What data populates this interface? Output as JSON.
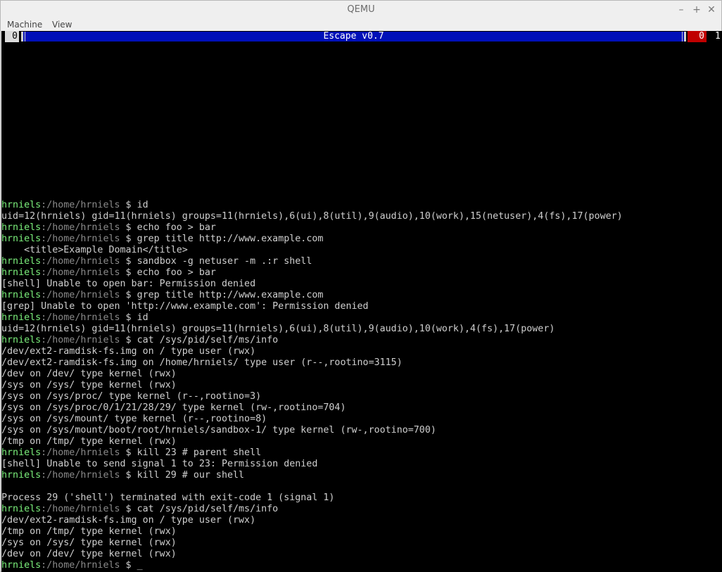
{
  "window": {
    "title": "QEMU",
    "minimize_glyph": "–",
    "maximize_glyph": "+",
    "close_glyph": "✕"
  },
  "menu": {
    "machine": "Machine",
    "view": "View"
  },
  "status": {
    "left_workspace": "0",
    "title": "Escape v0.7",
    "right_workspace_red": "0",
    "right_number": "1"
  },
  "terminal": {
    "user": "hrniels",
    "path": ":/home/hrniels",
    "prompt_symbol": " $ ",
    "lines": [
      {
        "type": "blank"
      },
      {
        "type": "prompt",
        "cmd": "id"
      },
      {
        "type": "output",
        "text": "uid=12(hrniels) gid=11(hrniels) groups=11(hrniels),6(ui),8(util),9(audio),10(work),15(netuser),4(fs),17(power)"
      },
      {
        "type": "prompt",
        "cmd": "echo foo > bar"
      },
      {
        "type": "prompt",
        "cmd": "grep title http://www.example.com"
      },
      {
        "type": "output",
        "text": "    <title>Example Domain</title>"
      },
      {
        "type": "prompt",
        "cmd": "sandbox -g netuser -m .:r shell"
      },
      {
        "type": "prompt",
        "cmd": "echo foo > bar"
      },
      {
        "type": "output",
        "text": "[shell] Unable to open bar: Permission denied"
      },
      {
        "type": "prompt",
        "cmd": "grep title http://www.example.com"
      },
      {
        "type": "output",
        "text": "[grep] Unable to open 'http://www.example.com': Permission denied"
      },
      {
        "type": "prompt",
        "cmd": "id"
      },
      {
        "type": "output",
        "text": "uid=12(hrniels) gid=11(hrniels) groups=11(hrniels),6(ui),8(util),9(audio),10(work),4(fs),17(power)"
      },
      {
        "type": "prompt",
        "cmd": "cat /sys/pid/self/ms/info"
      },
      {
        "type": "output",
        "text": "/dev/ext2-ramdisk-fs.img on / type user (rwx)"
      },
      {
        "type": "output",
        "text": "/dev/ext2-ramdisk-fs.img on /home/hrniels/ type user (r--,rootino=3115)"
      },
      {
        "type": "output",
        "text": "/dev on /dev/ type kernel (rwx)"
      },
      {
        "type": "output",
        "text": "/sys on /sys/ type kernel (rwx)"
      },
      {
        "type": "output",
        "text": "/sys on /sys/proc/ type kernel (r--,rootino=3)"
      },
      {
        "type": "output",
        "text": "/sys on /sys/proc/0/1/21/28/29/ type kernel (rw-,rootino=704)"
      },
      {
        "type": "output",
        "text": "/sys on /sys/mount/ type kernel (r--,rootino=8)"
      },
      {
        "type": "output",
        "text": "/sys on /sys/mount/boot/root/hrniels/sandbox-1/ type kernel (rw-,rootino=700)"
      },
      {
        "type": "output",
        "text": "/tmp on /tmp/ type kernel (rwx)"
      },
      {
        "type": "prompt",
        "cmd": "kill 23 # parent shell"
      },
      {
        "type": "output",
        "text": "[shell] Unable to send signal 1 to 23: Permission denied"
      },
      {
        "type": "prompt",
        "cmd": "kill 29 # our shell"
      },
      {
        "type": "blank"
      },
      {
        "type": "output",
        "text": "Process 29 ('shell') terminated with exit-code 1 (signal 1)"
      },
      {
        "type": "prompt",
        "cmd": "cat /sys/pid/self/ms/info"
      },
      {
        "type": "output",
        "text": "/dev/ext2-ramdisk-fs.img on / type user (rwx)"
      },
      {
        "type": "output",
        "text": "/tmp on /tmp/ type kernel (rwx)"
      },
      {
        "type": "output",
        "text": "/sys on /sys/ type kernel (rwx)"
      },
      {
        "type": "output",
        "text": "/dev on /dev/ type kernel (rwx)"
      },
      {
        "type": "prompt",
        "cmd": "_",
        "cursor": true
      }
    ]
  },
  "colors": {
    "user": "#7cf07c",
    "path": "#8a8a8a",
    "text": "#cfcfcf",
    "escape_bar": "#0010b8",
    "red_workspace": "#c00000"
  }
}
